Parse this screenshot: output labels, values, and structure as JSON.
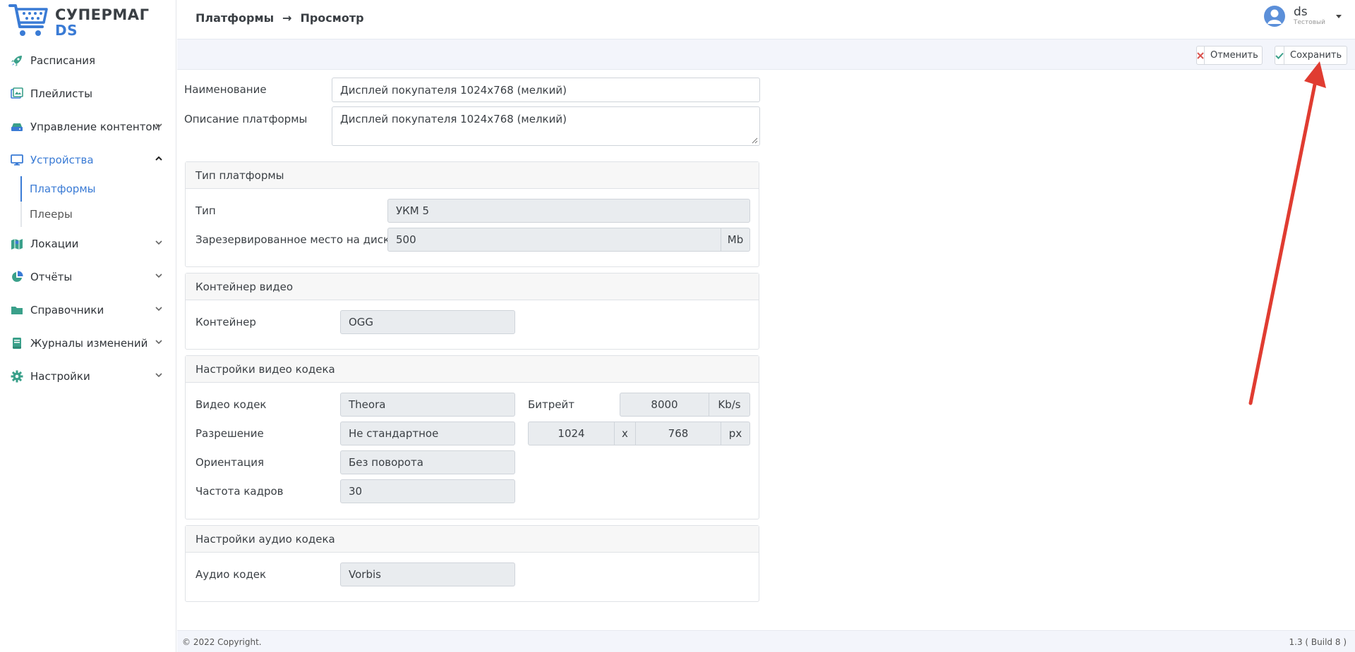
{
  "app": {
    "logo_line1": "СУПЕРМАГ",
    "logo_line2": "DS"
  },
  "sidebar": {
    "items": [
      {
        "label": "Расписания",
        "icon": "rocket-icon"
      },
      {
        "label": "Плейлисты",
        "icon": "playlist-icon"
      },
      {
        "label": "Управление контентом",
        "icon": "drive-icon"
      },
      {
        "label": "Устройства",
        "icon": "monitor-icon"
      },
      {
        "label": "Локации",
        "icon": "map-icon"
      },
      {
        "label": "Отчёты",
        "icon": "pie-chart-icon"
      },
      {
        "label": "Справочники",
        "icon": "folder-icon"
      },
      {
        "label": "Журналы изменений",
        "icon": "book-icon"
      },
      {
        "label": "Настройки",
        "icon": "gear-icon"
      }
    ],
    "sub_items": [
      {
        "label": "Платформы"
      },
      {
        "label": "Плееры"
      }
    ]
  },
  "header": {
    "breadcrumb_1": "Платформы",
    "breadcrumb_sep": "→",
    "breadcrumb_2": "Просмотр",
    "user_name": "ds",
    "user_role": "Тестовый"
  },
  "toolbar": {
    "cancel_label": "Отменить",
    "save_label": "Сохранить"
  },
  "form": {
    "name_label": "Наименование",
    "name_value": "Дисплей покупателя 1024x768 (мелкий)",
    "desc_label": "Описание платформы",
    "desc_value": "Дисплей покупателя 1024x768 (мелкий)"
  },
  "platform_type": {
    "title": "Тип платформы",
    "type_label": "Тип",
    "type_value": "УКМ 5",
    "disk_label": "Зарезервированное место на диске",
    "disk_value": "500",
    "disk_unit": "Mb"
  },
  "video_container": {
    "title": "Контейнер видео",
    "container_label": "Контейнер",
    "container_value": "OGG"
  },
  "video_codec": {
    "title": "Настройки видео кодека",
    "codec_label": "Видео кодек",
    "codec_value": "Theora",
    "bitrate_label": "Битрейт",
    "bitrate_value": "8000",
    "bitrate_unit": "Kb/s",
    "resolution_label": "Разрешение",
    "resolution_value": "Не стандартное",
    "width_value": "1024",
    "times": "x",
    "height_value": "768",
    "px_unit": "px",
    "orientation_label": "Ориентация",
    "orientation_value": "Без поворота",
    "fps_label": "Частота кадров",
    "fps_value": "30"
  },
  "audio_codec": {
    "title": "Настройки аудио кодека",
    "codec_label": "Аудио кодек",
    "codec_value": "Vorbis"
  },
  "footer": {
    "copyright": "© 2022 Copyright.",
    "version": "1.3 ( Build 8 )"
  },
  "colors": {
    "accent": "#3a7bd5",
    "sidebar_icon": "#3aa08a",
    "annotation_arrow": "#e03c31"
  }
}
